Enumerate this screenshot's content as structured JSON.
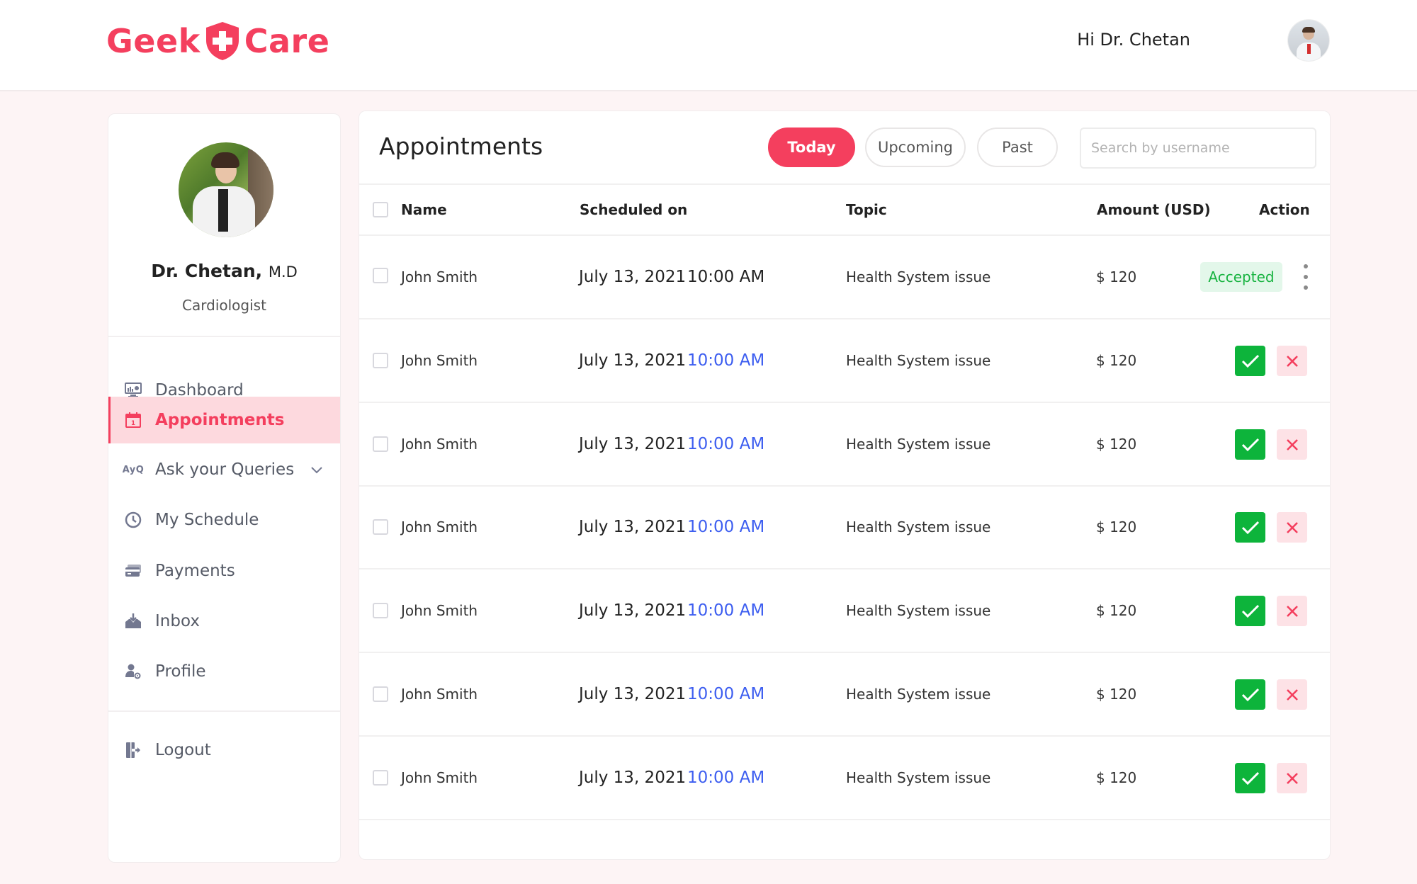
{
  "brand": {
    "name_left": "Geek",
    "name_right": "Care",
    "color": "#f43f5e",
    "logo_icon": "shield-plus-icon"
  },
  "header": {
    "greeting": "Hi Dr. Chetan",
    "avatar_icon": "doctor-avatar"
  },
  "sidebar": {
    "doctor_name": "Dr. Chetan,",
    "doctor_suffix": "M.D",
    "specialty": "Cardiologist",
    "items": [
      {
        "label": "Dashboard",
        "icon": "dashboard-monitor-icon",
        "active": false
      },
      {
        "label": "Appointments",
        "icon": "calendar-icon",
        "active": true
      },
      {
        "label": "Ask your Queries",
        "icon": "ayq-icon",
        "icon_text": "AyQ",
        "active": false,
        "expandable": true
      },
      {
        "label": "My Schedule",
        "icon": "clock-icon",
        "active": false
      },
      {
        "label": "Payments",
        "icon": "credit-card-icon",
        "active": false
      },
      {
        "label": "Inbox",
        "icon": "inbox-download-icon",
        "active": false
      },
      {
        "label": "Profile",
        "icon": "user-gear-icon",
        "active": false
      }
    ],
    "logout": {
      "label": "Logout",
      "icon": "logout-door-icon"
    }
  },
  "main": {
    "title": "Appointments",
    "tabs": [
      {
        "label": "Today",
        "active": true
      },
      {
        "label": "Upcoming",
        "active": false
      },
      {
        "label": "Past",
        "active": false
      }
    ],
    "search": {
      "placeholder": "Search by username",
      "value": ""
    },
    "columns": [
      "Name",
      "Scheduled on",
      "Topic",
      "Amount (USD)",
      "Action"
    ],
    "rows": [
      {
        "name": "John Smith",
        "date": "July 13, 2021",
        "time": "10:00 AM",
        "topic": "Health System issue",
        "amount": "$ 120",
        "status": "Accepted"
      },
      {
        "name": "John Smith",
        "date": "July 13, 2021",
        "time": "10:00 AM",
        "topic": "Health System issue",
        "amount": "$ 120",
        "status": "pending"
      },
      {
        "name": "John Smith",
        "date": "July 13, 2021",
        "time": "10:00 AM",
        "topic": "Health System issue",
        "amount": "$ 120",
        "status": "pending"
      },
      {
        "name": "John Smith",
        "date": "July 13, 2021",
        "time": "10:00 AM",
        "topic": "Health System issue",
        "amount": "$ 120",
        "status": "pending"
      },
      {
        "name": "John Smith",
        "date": "July 13, 2021",
        "time": "10:00 AM",
        "topic": "Health System issue",
        "amount": "$ 120",
        "status": "pending"
      },
      {
        "name": "John Smith",
        "date": "July 13, 2021",
        "time": "10:00 AM",
        "topic": "Health System issue",
        "amount": "$ 120",
        "status": "pending"
      },
      {
        "name": "John Smith",
        "date": "July 13, 2021",
        "time": "10:00 AM",
        "topic": "Health System issue",
        "amount": "$ 120",
        "status": "pending"
      }
    ],
    "colors": {
      "accept": "#0db43b",
      "reject_bg": "#fde2e6",
      "reject_icon": "#f43f5e",
      "time": "#3d5ef0",
      "accepted_bg": "#e3f7ea",
      "accepted_text": "#17b340"
    }
  }
}
